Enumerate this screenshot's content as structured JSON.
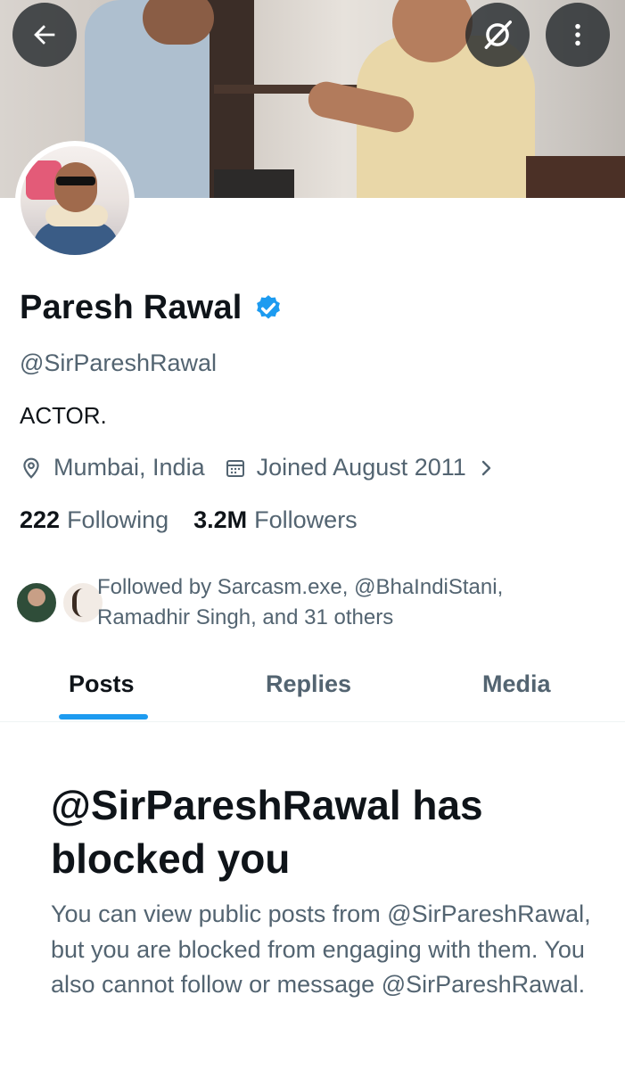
{
  "profile": {
    "name": "Paresh Rawal",
    "handle": "@SirPareshRawal",
    "bio": "ACTOR.",
    "location": "Mumbai, India",
    "joined": "Joined August 2011",
    "following_count": "222",
    "following_label": "Following",
    "followers_count": "3.2M",
    "followers_label": "Followers",
    "followed_by": "Followed by Sarcasm.exe, @BhaIndiStani, Ramadhir Singh, and 31 others"
  },
  "tabs": [
    {
      "label": "Posts",
      "active": true
    },
    {
      "label": "Replies",
      "active": false
    },
    {
      "label": "Media",
      "active": false
    }
  ],
  "blocked": {
    "title": "@SirPareshRawal has blocked you",
    "body": "You can view public posts from @SirPareshRawal, but you are blocked from engaging with them. You also cannot follow or message @SirPareshRawal."
  },
  "icons": {
    "back": "arrow-left-icon",
    "grok": "grok-icon",
    "more": "more-vertical-icon",
    "verified": "verified-badge-icon",
    "location": "location-pin-icon",
    "calendar": "calendar-icon",
    "chevron": "chevron-right-icon"
  },
  "colors": {
    "accent": "#1d9bf0",
    "text_primary": "#0f1419",
    "text_secondary": "#536471"
  }
}
